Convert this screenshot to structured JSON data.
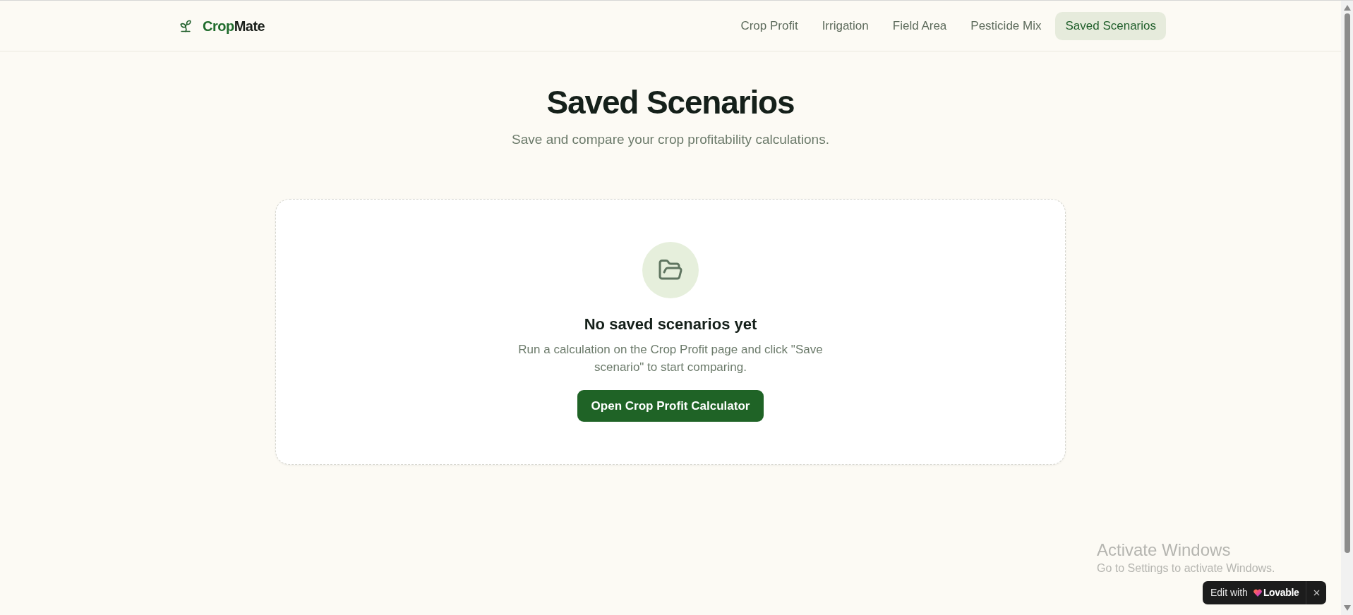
{
  "header": {
    "brand": {
      "lead": "Crop",
      "tail": "Mate"
    },
    "nav": [
      {
        "label": "Crop Profit",
        "selected": false
      },
      {
        "label": "Irrigation",
        "selected": false
      },
      {
        "label": "Field Area",
        "selected": false
      },
      {
        "label": "Pesticide Mix",
        "selected": false
      },
      {
        "label": "Saved Scenarios",
        "selected": true
      }
    ]
  },
  "page": {
    "title": "Saved Scenarios",
    "subtitle": "Save and compare your crop profitability calculations."
  },
  "empty_state": {
    "heading": "No saved scenarios yet",
    "description": "Run a calculation on the Crop Profit page and click \"Save scenario\" to start comparing.",
    "button": "Open Crop Profit Calculator"
  },
  "os_notice": {
    "title": "Activate Windows",
    "subtitle": "Go to Settings to activate Windows."
  },
  "edit_badge": {
    "prefix": "Edit with",
    "brand": "Lovable"
  }
}
